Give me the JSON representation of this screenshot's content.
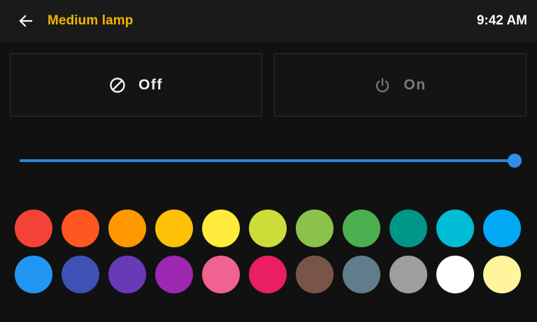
{
  "header": {
    "back_icon": "arrow-left-icon",
    "title": "Medium lamp",
    "time": "9:42 AM"
  },
  "power": {
    "off": {
      "label": "Off",
      "icon": "block-icon",
      "selected": true
    },
    "on": {
      "label": "On",
      "icon": "power-icon",
      "selected": false
    }
  },
  "brightness": {
    "value": 1.0
  },
  "colors": {
    "row1": [
      "#f44336",
      "#ff5722",
      "#ff9800",
      "#ffc107",
      "#ffeb3b",
      "#cddc39",
      "#8bc34a",
      "#4caf50",
      "#009688",
      "#00bcd4",
      "#03a9f4"
    ],
    "row2": [
      "#2196f3",
      "#3f51b5",
      "#673ab7",
      "#9c27b0",
      "#f06292",
      "#e91e63",
      "#795548",
      "#607d8b",
      "#9e9e9e",
      "#ffffff",
      "#fff59d"
    ]
  },
  "accent": "#f4b400"
}
